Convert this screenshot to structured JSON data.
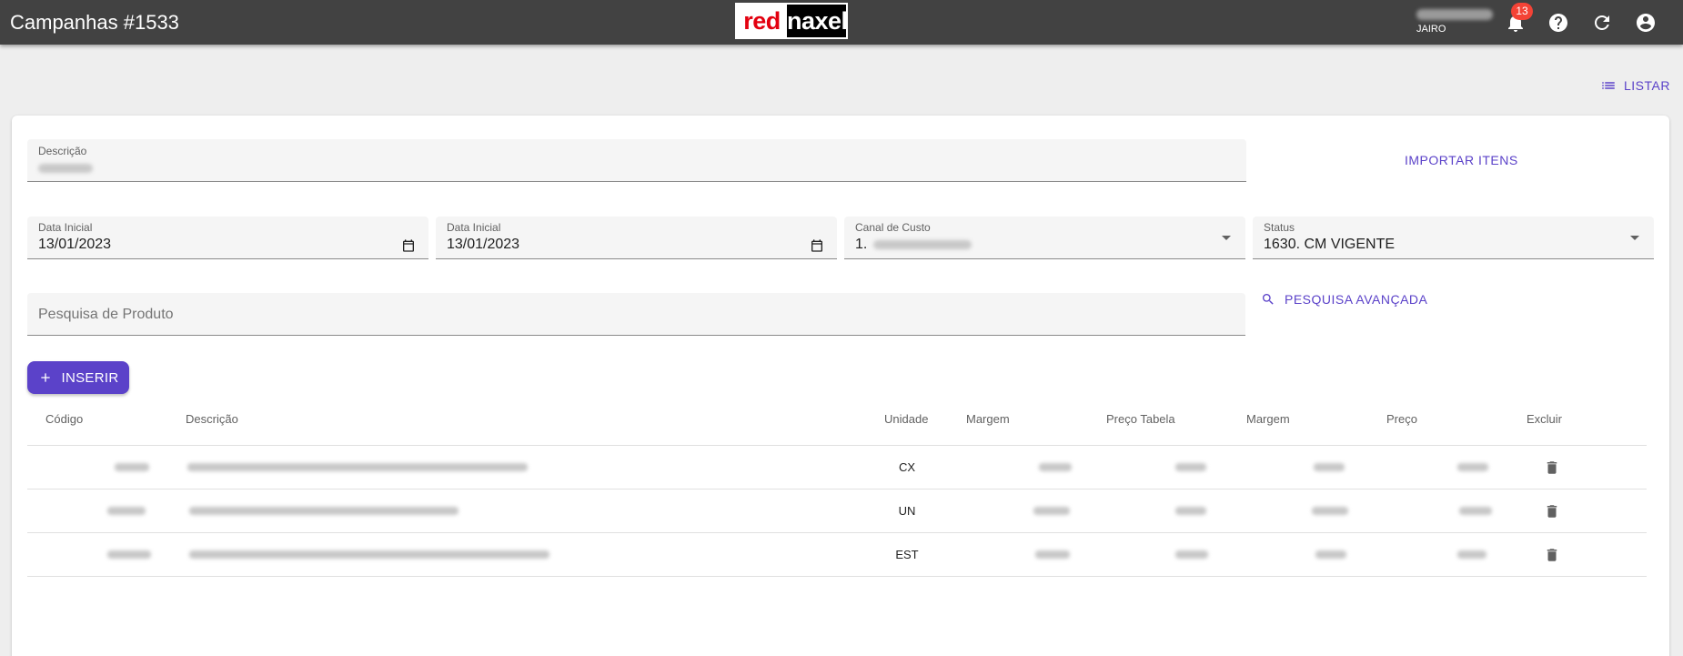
{
  "appbar": {
    "title": "Campanhas #1533",
    "logo_part1": "red",
    "logo_part2": "naxel",
    "user_name": "JAIRO",
    "notifications_count": "13"
  },
  "toolbar": {
    "listar_label": "LISTAR"
  },
  "form": {
    "descricao_label": "Descrição",
    "importar_label": "IMPORTAR ITENS",
    "data_inicial_1_label": "Data Inicial",
    "data_inicial_1_value": "13/01/2023",
    "data_inicial_2_label": "Data Inicial",
    "data_inicial_2_value": "13/01/2023",
    "canal_label": "Canal de Custo",
    "canal_value_prefix": "1.",
    "status_label": "Status",
    "status_value": "1630. CM VIGENTE",
    "pesquisa_placeholder": "Pesquisa de Produto",
    "pesquisa_avancada_label": "PESQUISA AVANÇADA",
    "inserir_label": "INSERIR"
  },
  "table": {
    "headers": [
      "Código",
      "Descrição",
      "Unidade",
      "Margem",
      "Preço Tabela",
      "Margem",
      "Preço",
      "Excluir"
    ],
    "rows": [
      {
        "unidade": "CX"
      },
      {
        "unidade": "UN"
      },
      {
        "unidade": "EST"
      }
    ]
  },
  "colors": {
    "appbar": "#424242",
    "accent": "#5b42c9",
    "badge": "#f44336",
    "logo_red": "#e3000f"
  }
}
